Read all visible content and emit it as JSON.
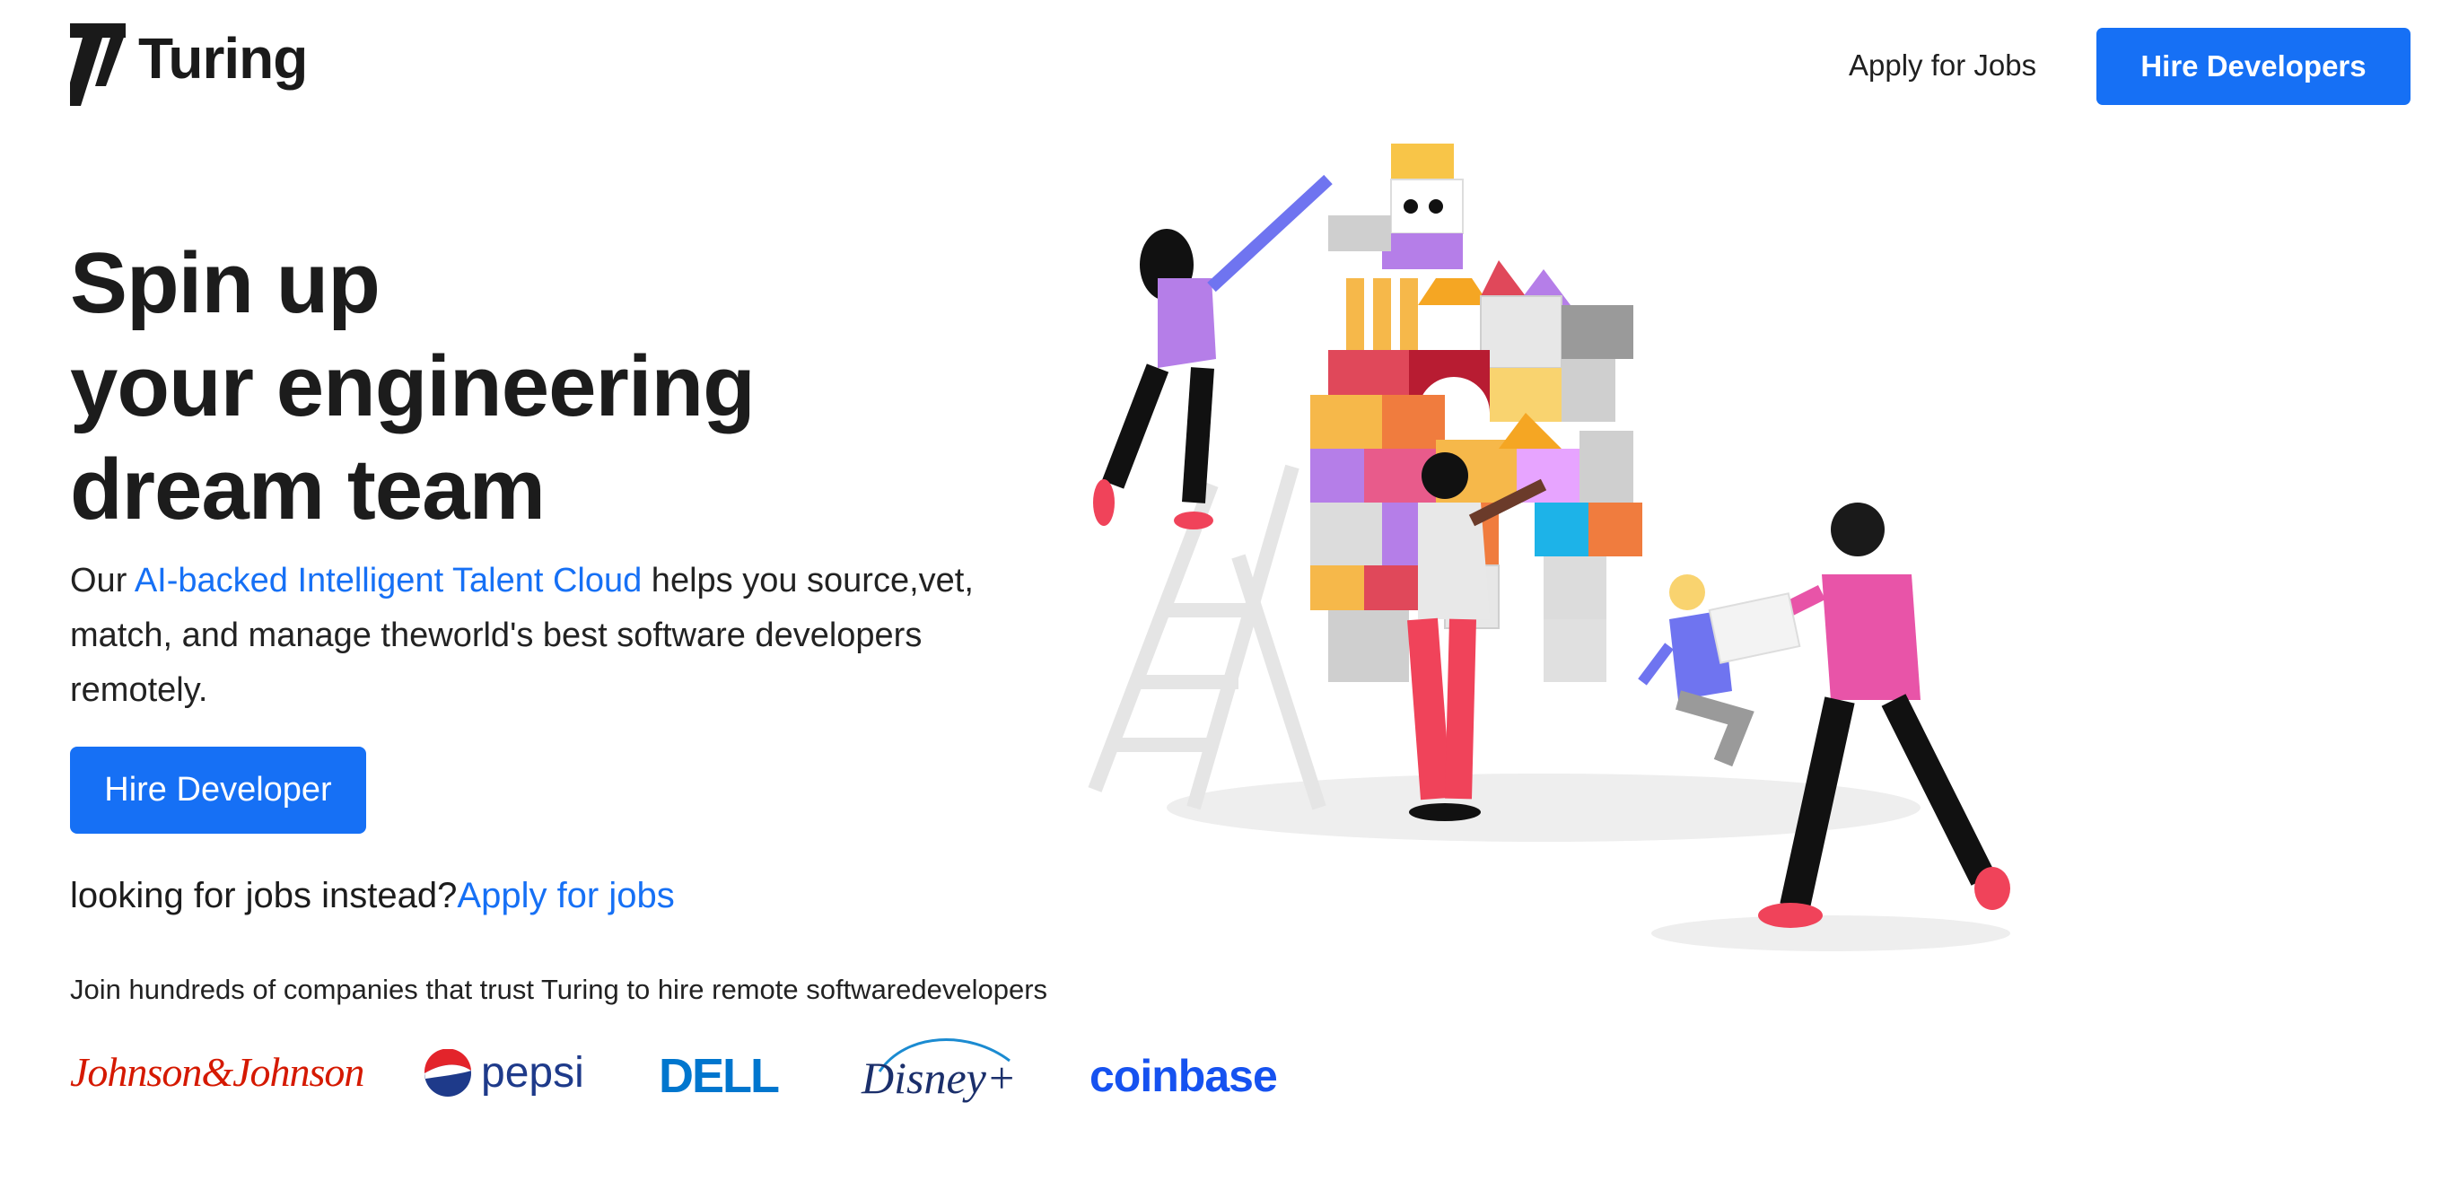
{
  "header": {
    "brand": "Turing",
    "nav_link": "Apply for Jobs",
    "cta": "Hire Developers"
  },
  "hero": {
    "title_lines": [
      "Spin up",
      "your engineering",
      "dream team"
    ],
    "desc_prefix": "Our ",
    "desc_link": "AI-backed Intelligent Talent Cloud",
    "desc_suffix": " helps you source,vet, match, and manage theworld's best software developers remotely.",
    "cta": "Hire Developer",
    "jobs_prompt": "looking for jobs instead?",
    "jobs_link": "Apply for jobs",
    "trust_text": "Join hundreds of companies that trust Turing to hire remote softwaredevelopers"
  },
  "companies": {
    "jnj": "Johnson&Johnson",
    "pepsi": "pepsi",
    "dell": "DELL",
    "disney": "Disney+",
    "coinbase": "coinbase"
  },
  "colors": {
    "accent": "#1670f5",
    "text": "#1f1f1f"
  }
}
